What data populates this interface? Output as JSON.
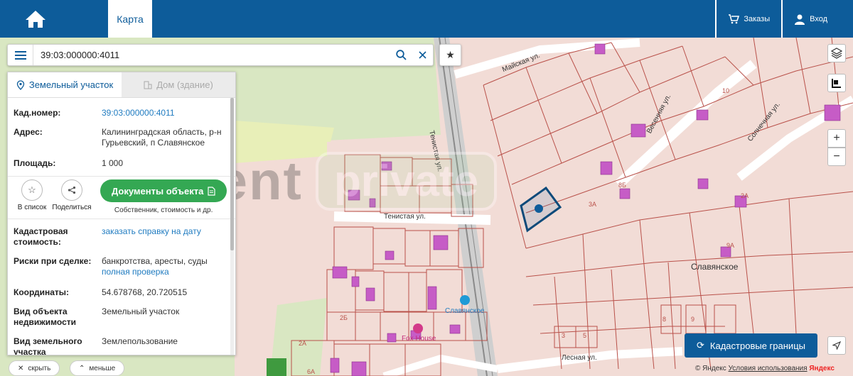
{
  "header": {
    "map_tab": "Карта",
    "orders_label": "Заказы",
    "login_label": "Вход"
  },
  "search": {
    "value": "39:03:000000:4011"
  },
  "panel": {
    "tabs": [
      {
        "label": "Земельный участок"
      },
      {
        "label": "Дом (здание)"
      }
    ],
    "rows_top": [
      {
        "label": "Кад.номер:",
        "value": "39:03:000000:4011"
      },
      {
        "label": "Адрес:",
        "value": "Калининградская область, р-н Гурьевский, п Славянское"
      },
      {
        "label": "Площадь:",
        "value": "1 000"
      }
    ],
    "actions": {
      "favorite": "В список",
      "share": "Поделиться",
      "docs_button": "Документы объекта",
      "docs_sub": "Собственник, стоимость и др."
    },
    "rows_bottom": [
      {
        "label": "Кадастровая стоимость:",
        "value": "заказать справку на дату",
        "link": true
      },
      {
        "label": "Риски при сделке:",
        "value": "банкротства, аресты, суды",
        "value2": "полная проверка"
      },
      {
        "label": "Координаты:",
        "value": "54.678768, 20.720515"
      },
      {
        "label": "Вид объекта недвижимости",
        "value": "Земельный участок"
      },
      {
        "label": "Вид земельного участка",
        "value": "Землепользование"
      }
    ]
  },
  "bottom": {
    "hide_label": "скрыть",
    "less_label": "меньше"
  },
  "map": {
    "labels": {
      "street_tenistaya": "Тенистая ул.",
      "street_tenistaya2": "Тенистая ул.",
      "street_mayskaya": "Майская ул.",
      "street_vesennyaya": "Весенняя ул.",
      "street_solnechnaya": "Солнечная ул.",
      "street_lesnaya": "Лесная ул.",
      "place": "Славянское",
      "place2": "Славянское",
      "poi": "Fox House",
      "parcel_2A": "2А",
      "parcel_9A": "9А",
      "parcel_3A": "3А",
      "parcel_8B": "8Б",
      "parcel_10": "10",
      "parcel_9": "9",
      "parcel_8": "8",
      "parcel_3": "3",
      "parcel_5": "5",
      "parcel_2B": "2Б",
      "parcel_2A_left": "2А",
      "parcel_6A": "6А"
    }
  },
  "cadastral_button": "Кадастровые границы",
  "attribution": {
    "copy": "© Яндекс",
    "terms": "Условия использования",
    "brand": "Яндекс"
  },
  "watermark": {
    "text": "invent",
    "box": "private"
  },
  "colors": {
    "brand": "#0d5c9a",
    "docs_green": "#34a853",
    "parcel_fill": "#f2dcd6",
    "parcel_stroke": "#b9514a",
    "building": "#c65cc6"
  },
  "icons": [
    "home-icon",
    "cart-icon",
    "user-icon",
    "menu-icon",
    "search-icon",
    "clear-icon",
    "star-icon",
    "map-pin-icon",
    "building-icon",
    "share-icon",
    "document-icon",
    "layers-icon",
    "ruler-icon",
    "zoom-in-icon",
    "zoom-out-icon",
    "refresh-icon",
    "locate-icon",
    "close-icon",
    "chevron-up-icon"
  ]
}
